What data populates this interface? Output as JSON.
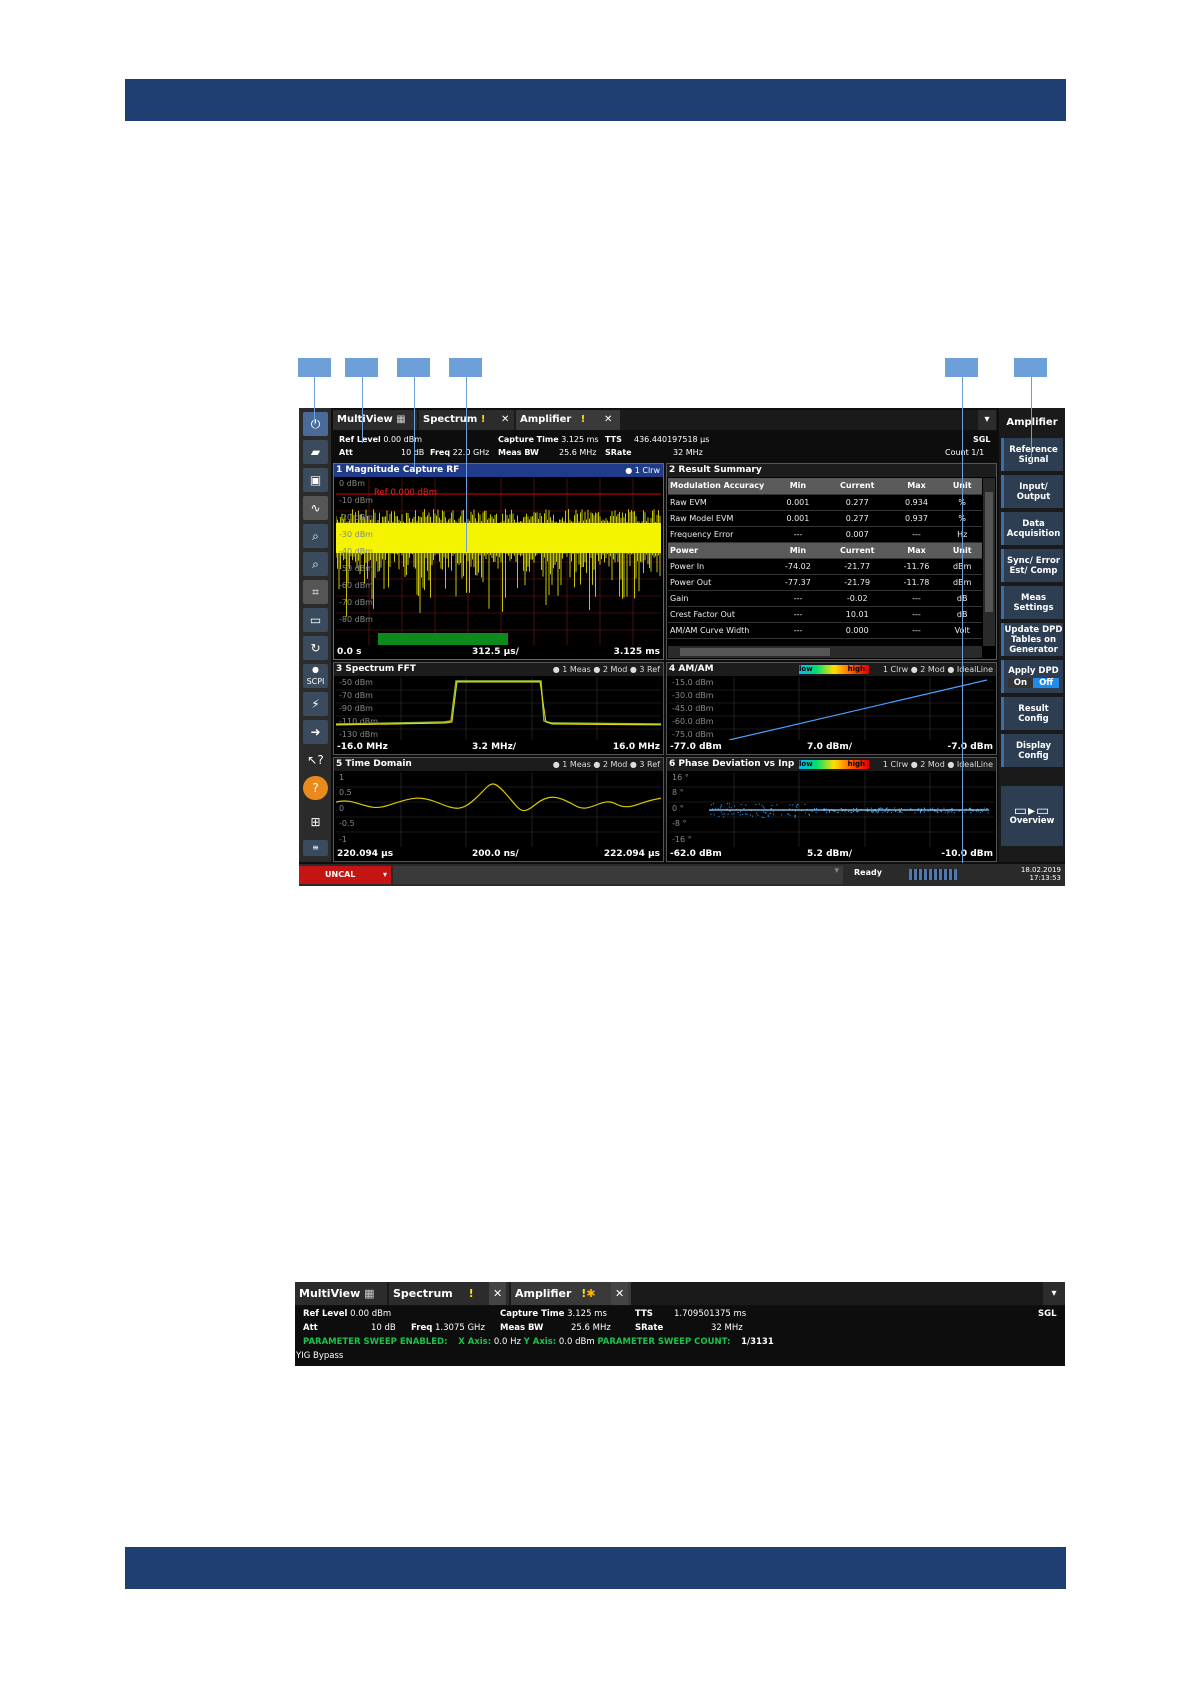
{
  "app": {
    "tabs": [
      {
        "label": "MultiView"
      },
      {
        "label": "Spectrum"
      },
      {
        "label": "Amplifier"
      }
    ],
    "info": {
      "ref_level_label": "Ref Level",
      "ref_level": "0.00 dBm",
      "att_label": "Att",
      "att": "10 dB",
      "freq_label": "Freq",
      "freq": "22.0 GHz",
      "capture_time_label": "Capture Time",
      "capture_time": "3.125 ms",
      "tts_label": "TTS",
      "tts": "436.440197518 µs",
      "meas_bw_label": "Meas BW",
      "meas_bw": "25.6 MHz",
      "srate_label": "SRate",
      "srate": "32 MHz",
      "sgl": "SGL",
      "count": "Count 1/1"
    },
    "panel1": {
      "title": "1 Magnitude Capture RF",
      "legend": "● 1 Clrw",
      "ref_line": "Ref 0.000 dBm",
      "y_labels": [
        "0 dBm",
        "-10 dBm",
        "-20 dBm",
        "-30 dBm",
        "-40 dBm",
        "-50 dBm",
        "-60 dBm",
        "-70 dBm",
        "-80 dBm"
      ],
      "foot_left": "0.0 s",
      "foot_mid": "312.5 µs/",
      "foot_right": "3.125 ms"
    },
    "panel2": {
      "title": "2 Result Summary",
      "head1": [
        "Modulation Accuracy",
        "Min",
        "Current",
        "Max",
        "Unit"
      ],
      "rows1": [
        [
          "Raw EVM",
          "0.001",
          "0.277",
          "0.934",
          "%"
        ],
        [
          "Raw Model EVM",
          "0.001",
          "0.277",
          "0.937",
          "%"
        ],
        [
          "Frequency Error",
          "---",
          "0.007",
          "---",
          "Hz"
        ]
      ],
      "head2": [
        "Power",
        "Min",
        "Current",
        "Max",
        "Unit"
      ],
      "rows2": [
        [
          "Power In",
          "-74.02",
          "-21.77",
          "-11.76",
          "dBm"
        ],
        [
          "Power Out",
          "-77.37",
          "-21.79",
          "-11.78",
          "dBm"
        ],
        [
          "Gain",
          "---",
          "-0.02",
          "---",
          "dB"
        ],
        [
          "Crest Factor Out",
          "---",
          "10.01",
          "---",
          "dB"
        ],
        [
          "AM/AM Curve Width",
          "---",
          "0.000",
          "---",
          "Volt"
        ]
      ]
    },
    "panel3": {
      "title": "3 Spectrum FFT",
      "legend": "● 1 Meas ● 2 Mod ● 3 Ref",
      "y_labels": [
        "-50 dBm",
        "-70 dBm",
        "-90 dBm",
        "-110 dBm",
        "-130 dBm"
      ],
      "foot_left": "-16.0 MHz",
      "foot_mid": "3.2 MHz/",
      "foot_right": "16.0 MHz"
    },
    "panel4": {
      "title": "4 AM/AM",
      "low": "low",
      "high": "high",
      "legend": "1 Clrw ● 2 Mod ● IdealLine",
      "y_labels": [
        "-15.0 dBm",
        "-30.0 dBm",
        "-45.0 dBm",
        "-60.0 dBm",
        "-75.0 dBm"
      ],
      "foot_left": "-77.0 dBm",
      "foot_mid": "7.0 dBm/",
      "foot_right": "-7.0 dBm"
    },
    "panel5": {
      "title": "5 Time Domain",
      "legend": "● 1 Meas ● 2 Mod ● 3 Ref",
      "y_labels": [
        "1",
        "0.5",
        "0",
        "-0.5",
        "-1"
      ],
      "foot_left": "220.094 µs",
      "foot_mid": "200.0 ns/",
      "foot_right": "222.094 µs"
    },
    "panel6": {
      "title": "6 Phase Deviation vs Inp",
      "low": "low",
      "high": "high",
      "legend": "1 Clrw ● 2 Mod ● IdealLine",
      "y_labels": [
        "16 °",
        "8 °",
        "0 °",
        "-8 °",
        "-16 °"
      ],
      "foot_left": "-62.0 dBm",
      "foot_mid": "5.2 dBm/",
      "foot_right": "-10.0 dBm"
    },
    "softkeys": {
      "title": "Amplifier",
      "items": [
        "Reference Signal",
        "Input/ Output",
        "Data Acquisition",
        "Sync/ Error Est/ Comp",
        "Meas Settings",
        "Update DPD Tables on Generator",
        "Apply DPD",
        "Result Config",
        "Display Config",
        "Overview"
      ],
      "apply_on": "On",
      "apply_off": "Off"
    },
    "toolbar": {
      "scpi": "SCPI"
    },
    "status": {
      "uncal": "UNCAL",
      "ready": "Ready",
      "date": "18.02.2019",
      "time": "17:13:53"
    }
  },
  "second": {
    "tabs": [
      {
        "label": "MultiView"
      },
      {
        "label": "Spectrum"
      },
      {
        "label": "Amplifier"
      }
    ],
    "ref_level_label": "Ref Level",
    "ref_level": "0.00 dBm",
    "att_label": "Att",
    "att": "10 dB",
    "freq_label": "Freq",
    "freq": "1.3075 GHz",
    "capture_time_label": "Capture Time",
    "capture_time": "3.125 ms",
    "tts_label": "TTS",
    "tts": "1.709501375 ms",
    "meas_bw_label": "Meas BW",
    "meas_bw": "25.6 MHz",
    "srate_label": "SRate",
    "srate": "32 MHz",
    "sgl": "SGL",
    "sweep_label": "PARAMETER SWEEP ENABLED:",
    "x_axis_label": "X Axis:",
    "x_axis": "0.0 Hz",
    "y_axis_label": "Y Axis:",
    "y_axis": "0.0 dBm",
    "sweep_count_label": "PARAMETER SWEEP COUNT:",
    "sweep_count": "1/3131",
    "yig": "YIG Bypass"
  }
}
